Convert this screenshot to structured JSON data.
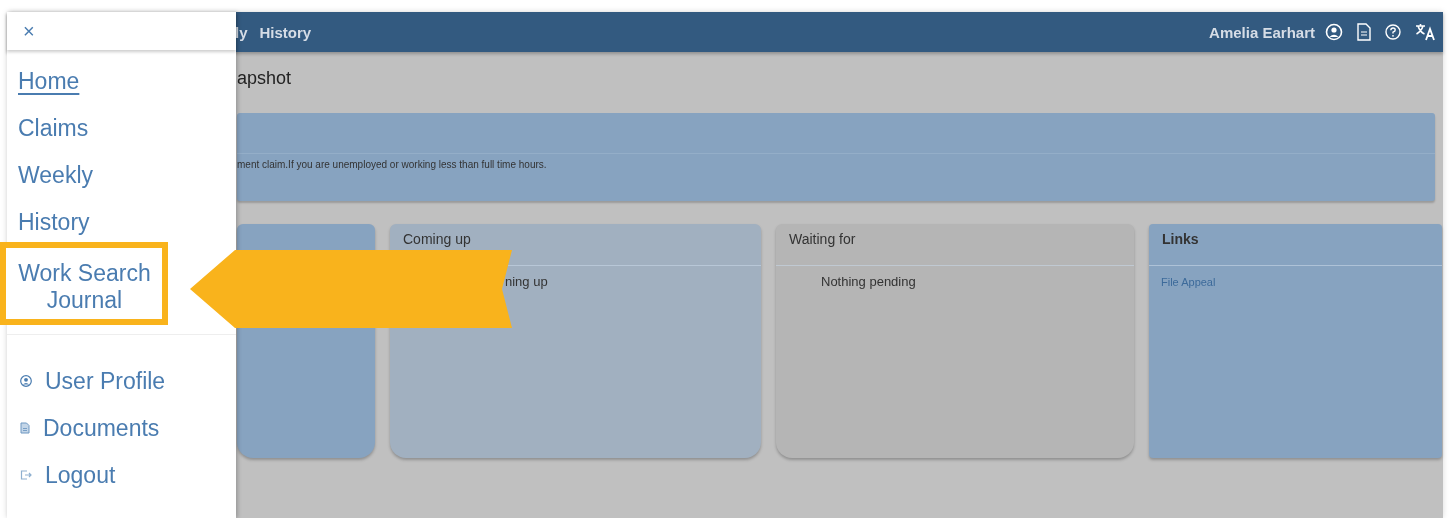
{
  "header": {
    "nav": [
      "ly",
      "History"
    ],
    "user": "Amelia Earhart"
  },
  "page_title": "apshot",
  "banner": {
    "text": "ment claim.If you are unemployed or working less than full time hours."
  },
  "cards": [
    {
      "color": "#87a3c0"
    },
    {
      "color": "#a1b0c0",
      "title": "Coming up",
      "body": "ning up"
    },
    {
      "color": "#b5b5b5",
      "title": "Waiting for",
      "body": "Nothing pending"
    },
    {
      "color": "#87a3c0",
      "title": "Links",
      "link": "File Appeal"
    }
  ],
  "drawer": {
    "close": "×",
    "items": [
      {
        "label": "Home",
        "selected": true,
        "highlighted": false
      },
      {
        "label": "Claims",
        "selected": false,
        "highlighted": false
      },
      {
        "label": "Weekly",
        "selected": false,
        "highlighted": false
      },
      {
        "label": "History",
        "selected": false,
        "highlighted": false
      },
      {
        "label": "Work Search Journal",
        "selected": false,
        "highlighted": true
      }
    ],
    "account_items": [
      {
        "label": "User Profile",
        "kind": "profile"
      },
      {
        "label": "Documents",
        "kind": "documents"
      },
      {
        "label": "Logout",
        "kind": "logout"
      }
    ]
  }
}
